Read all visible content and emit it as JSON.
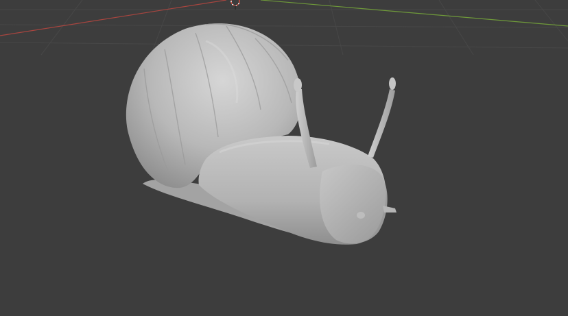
{
  "viewport": {
    "background_color": "#3d3d3d",
    "grid_color": "#4a4a4a",
    "x_axis_color": "#a8453f",
    "y_axis_color": "#6f9a3a",
    "cursor_icon": "3d-cursor-icon"
  },
  "model": {
    "shading": "solid",
    "base_color": "#b3b3b3",
    "highlight_color": "#d4d4d4",
    "shadow_color": "#7a7a7a"
  }
}
